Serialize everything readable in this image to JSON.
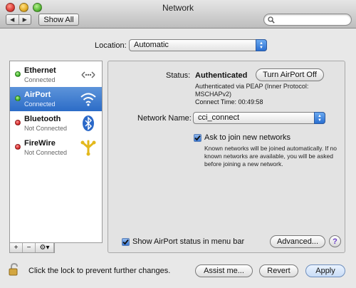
{
  "window": {
    "title": "Network",
    "show_all_label": "Show All",
    "search_placeholder": ""
  },
  "location": {
    "label": "Location:",
    "value": "Automatic"
  },
  "services": [
    {
      "name": "Ethernet",
      "status": "Connected",
      "status_color": "#3fb52a",
      "icon": "ethernet-icon"
    },
    {
      "name": "AirPort",
      "status": "Connected",
      "status_color": "#3fb52a",
      "icon": "wifi-icon",
      "selected": true
    },
    {
      "name": "Bluetooth",
      "status": "Not Connected",
      "status_color": "#d72a2a",
      "icon": "bluetooth-icon"
    },
    {
      "name": "FireWire",
      "status": "Not Connected",
      "status_color": "#d72a2a",
      "icon": "firewire-icon"
    }
  ],
  "list_controls": {
    "add": "+",
    "remove": "−",
    "gear": "⚙▾"
  },
  "detail": {
    "status_label": "Status:",
    "status_value": "Authenticated",
    "turn_off_label": "Turn AirPort Off",
    "status_desc": "Authenticated via PEAP (Inner Protocol: MSCHAPv2)",
    "connect_time": "Connect Time: 00:49:58",
    "network_name_label": "Network Name:",
    "network_name_value": "cci_connect",
    "ask_label": "Ask to join new networks",
    "ask_desc": "Known networks will be joined automatically. If no known networks are available, you will be asked before joining a new network.",
    "menubar_label": "Show AirPort status in menu bar",
    "advanced_label": "Advanced...",
    "help_label": "?"
  },
  "footer": {
    "lock_text": "Click the lock to prevent further changes.",
    "assist_label": "Assist me...",
    "revert_label": "Revert",
    "apply_label": "Apply"
  },
  "colors": {
    "selection": "#2c6cc7",
    "accent": "#3a78d4"
  }
}
